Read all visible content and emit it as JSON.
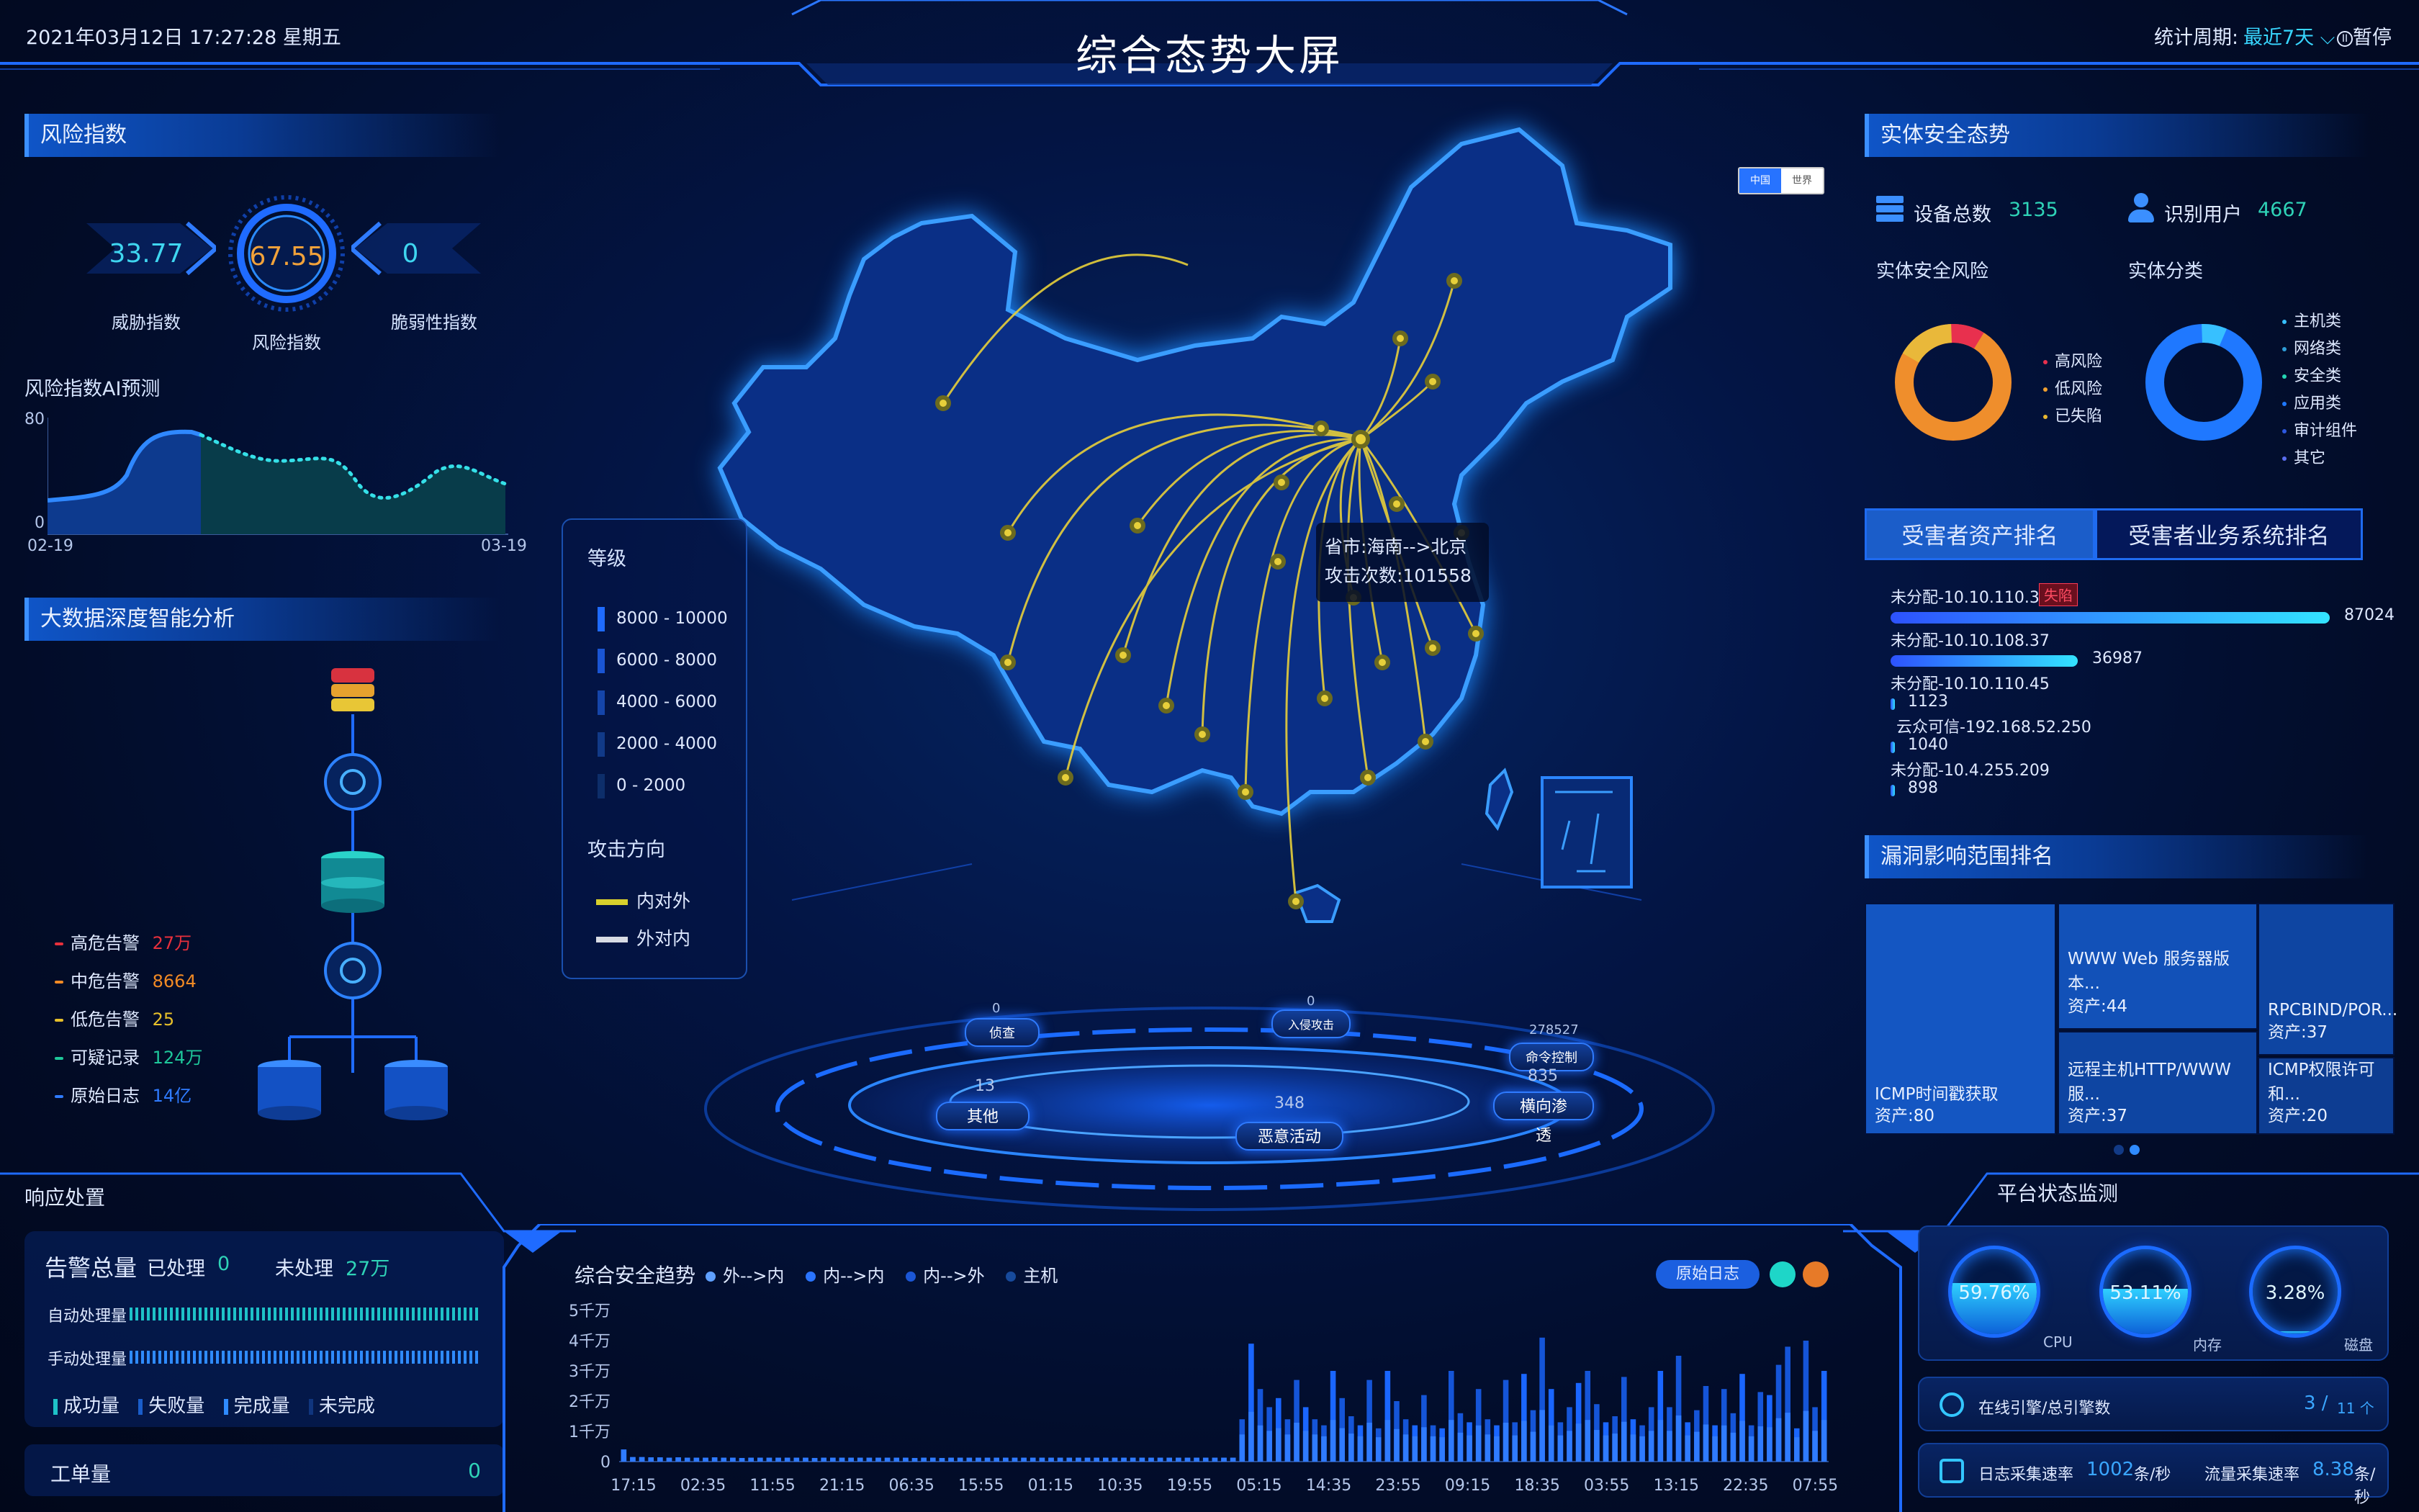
{
  "header": {
    "datetime": "2021年03月12日 17:27:28 星期五",
    "title": "综合态势大屏",
    "period_label": "统计周期:",
    "period_value": "最近7天",
    "pause_label": "暂停"
  },
  "risk": {
    "title": "风险指数",
    "threat_value": "33.77",
    "threat_label": "威胁指数",
    "risk_value": "67.55",
    "risk_label": "风险指数",
    "vuln_value": "0",
    "vuln_label": "脆弱性指数",
    "ai_title": "风险指数AI预测",
    "y_max": "80",
    "y_min": "0",
    "x_start": "02-19",
    "x_end": "03-19"
  },
  "bigdata": {
    "title": "大数据深度智能分析",
    "legend": [
      {
        "label": "高危告警",
        "value": "27万",
        "color": "#e8303c"
      },
      {
        "label": "中危告警",
        "value": "8664",
        "color": "#f28a24"
      },
      {
        "label": "低危告警",
        "value": "25",
        "color": "#e7c02a"
      },
      {
        "label": "可疑记录",
        "value": "124万",
        "color": "#1ec79a"
      },
      {
        "label": "原始日志",
        "value": "14亿",
        "color": "#2f7bff"
      }
    ]
  },
  "map": {
    "toggle_china": "中国",
    "toggle_world": "世界",
    "level_title": "等级",
    "levels": [
      "8000 - 10000",
      "6000 - 8000",
      "4000 - 6000",
      "2000 - 4000",
      "0 - 2000"
    ],
    "level_colors": [
      "#1f6bff",
      "#1a55d4",
      "#1545aa",
      "#113a88",
      "#0d2e6a"
    ],
    "direction_title": "攻击方向",
    "dir_out": "内对外",
    "dir_in": "外对内",
    "tooltip_line1": "省市:海南-->北京",
    "tooltip_line2": "攻击次数:101558"
  },
  "stages": {
    "recon": {
      "label": "侦查",
      "value": "0"
    },
    "intrusion": {
      "label": "入侵攻击",
      "value": "0"
    },
    "c2": {
      "label": "命令控制",
      "value": "278527"
    },
    "other": {
      "label": "其他",
      "value": "13"
    },
    "malicious": {
      "label": "恶意活动",
      "value": "348"
    },
    "lateral": {
      "label": "横向渗透",
      "value": "835"
    }
  },
  "entity": {
    "title": "实体安全态势",
    "devices_label": "设备总数",
    "devices_value": "3135",
    "users_label": "识别用户",
    "users_value": "4667",
    "risk_title": "实体安全风险",
    "risk_legend": [
      "高风险",
      "低风险",
      "已失陷"
    ],
    "risk_colors": [
      "#e8304e",
      "#f0a030",
      "#e8b730"
    ],
    "cat_title": "实体分类",
    "cat_legend": [
      "主机类",
      "网络类",
      "安全类",
      "应用类",
      "审计组件",
      "其它"
    ]
  },
  "ranking": {
    "tab1": "受害者资产排名",
    "tab2": "受害者业务系统排名",
    "items": [
      {
        "name": "未分配-10.10.110.39",
        "badge": "失陷",
        "value": "87024",
        "ratio": 1
      },
      {
        "name": "未分配-10.10.108.37",
        "badge": "",
        "value": "36987",
        "ratio": 0.425
      },
      {
        "name": "未分配-10.10.110.45",
        "badge": "",
        "value": "1123",
        "ratio": 0.013
      },
      {
        "name": "云众可信-192.168.52.250",
        "badge": "",
        "value": "1040",
        "ratio": 0.012
      },
      {
        "name": "未分配-10.4.255.209",
        "badge": "",
        "value": "898",
        "ratio": 0.01
      }
    ]
  },
  "vuln": {
    "title": "漏洞影响范围排名",
    "items": [
      {
        "name": "ICMP时间戳获取",
        "assets": "资产:80"
      },
      {
        "name": "WWW Web 服务器版本...",
        "assets": "资产:44"
      },
      {
        "name": "RPCBIND/POR...",
        "assets": "资产:37"
      },
      {
        "name": "远程主机HTTP/WWW服...",
        "assets": "资产:37"
      },
      {
        "name": "ICMP权限许可和...",
        "assets": "资产:20"
      }
    ]
  },
  "response": {
    "title": "响应处置",
    "alert_total_label": "告警总量",
    "handled_label": "已处理",
    "handled_value": "0",
    "unhandled_label": "未处理",
    "unhandled_value": "27万",
    "auto_label": "自动处理量",
    "manual_label": "手动处理量",
    "legend": [
      "成功量",
      "失败量",
      "完成量",
      "未完成"
    ],
    "work_label": "工单量",
    "work_value": "0"
  },
  "trend": {
    "title": "综合安全趋势",
    "legend": [
      "外-->内",
      "内-->内",
      "内-->外",
      "主机"
    ],
    "raw_btn": "原始日志"
  },
  "chart_data": {
    "type": "bar",
    "title": "综合安全趋势",
    "yticks": [
      "5千万",
      "4千万",
      "3千万",
      "2千万",
      "1千万",
      "0"
    ],
    "ylim": [
      0,
      50000000
    ],
    "xticks": [
      "17:15",
      "02:35",
      "11:55",
      "21:15",
      "06:35",
      "15:55",
      "01:15",
      "10:35",
      "19:55",
      "05:15",
      "14:35",
      "23:55",
      "09:15",
      "18:35",
      "03:55",
      "13:15",
      "22:35",
      "07:55"
    ],
    "series": [
      {
        "name": "外-->内",
        "values": [
          4000000,
          1500000,
          1500000,
          1400000,
          1400000,
          1300000,
          1400000,
          1300000,
          1300000,
          1300000,
          1400000,
          1300000,
          1300000,
          1200000,
          1300000,
          1300000,
          1300000,
          1300000,
          1300000,
          1300000,
          1300000,
          1200000,
          1300000,
          1300000,
          1300000,
          1300000,
          1300000,
          1300000,
          1300000,
          1300000,
          1300000,
          1300000,
          1200000,
          1300000,
          1300000,
          1200000,
          1300000,
          1300000,
          1300000,
          1300000,
          1300000,
          1300000,
          1300000,
          1300000,
          1300000,
          1300000,
          1300000,
          1300000,
          1300000,
          1300000,
          1300000,
          1300000,
          1300000,
          1300000,
          1300000,
          1300000,
          1300000,
          1300000,
          1300000,
          1300000,
          1300000,
          1300000,
          1300000,
          1300000,
          1300000,
          1300000,
          1300000,
          1300000,
          14000000,
          39000000,
          24000000,
          18000000,
          21000000,
          14000000,
          27000000,
          18000000,
          14000000,
          12000000,
          30000000,
          21000000,
          15000000,
          12000000,
          27000000,
          11000000,
          30000000,
          20000000,
          14000000,
          12000000,
          22000000,
          12000000,
          11000000,
          30000000,
          16000000,
          13000000,
          24000000,
          14000000,
          12000000,
          27000000,
          13000000,
          29000000,
          17000000,
          41000000,
          24000000,
          13000000,
          18000000,
          26000000,
          30000000,
          19000000,
          13000000,
          15000000,
          28000000,
          14000000,
          12000000,
          18000000,
          30000000,
          18000000,
          35000000,
          13000000,
          17000000,
          25000000,
          12000000,
          24000000,
          16000000,
          29000000,
          12000000,
          23000000,
          22000000,
          32000000,
          38000000,
          11000000,
          40000000,
          18000000,
          30000000
        ]
      }
    ]
  },
  "platform": {
    "title": "平台状态监测",
    "cpu_value": "59.76%",
    "cpu_label": "CPU",
    "cpu_ratio": 0.5976,
    "mem_value": "53.11%",
    "mem_label": "内存",
    "mem_ratio": 0.5311,
    "disk_value": "3.28%",
    "disk_label": "磁盘",
    "disk_ratio": 0.0328,
    "engine_label": "在线引擎/总引擎数",
    "engine_value": "3 /",
    "engine_total": "11 个",
    "log_rate_label": "日志采集速率",
    "log_rate_value": "1002",
    "log_rate_unit": "条/秒",
    "flow_rate_label": "流量采集速率",
    "flow_rate_value": "8.38",
    "flow_rate_unit": "条/秒"
  }
}
